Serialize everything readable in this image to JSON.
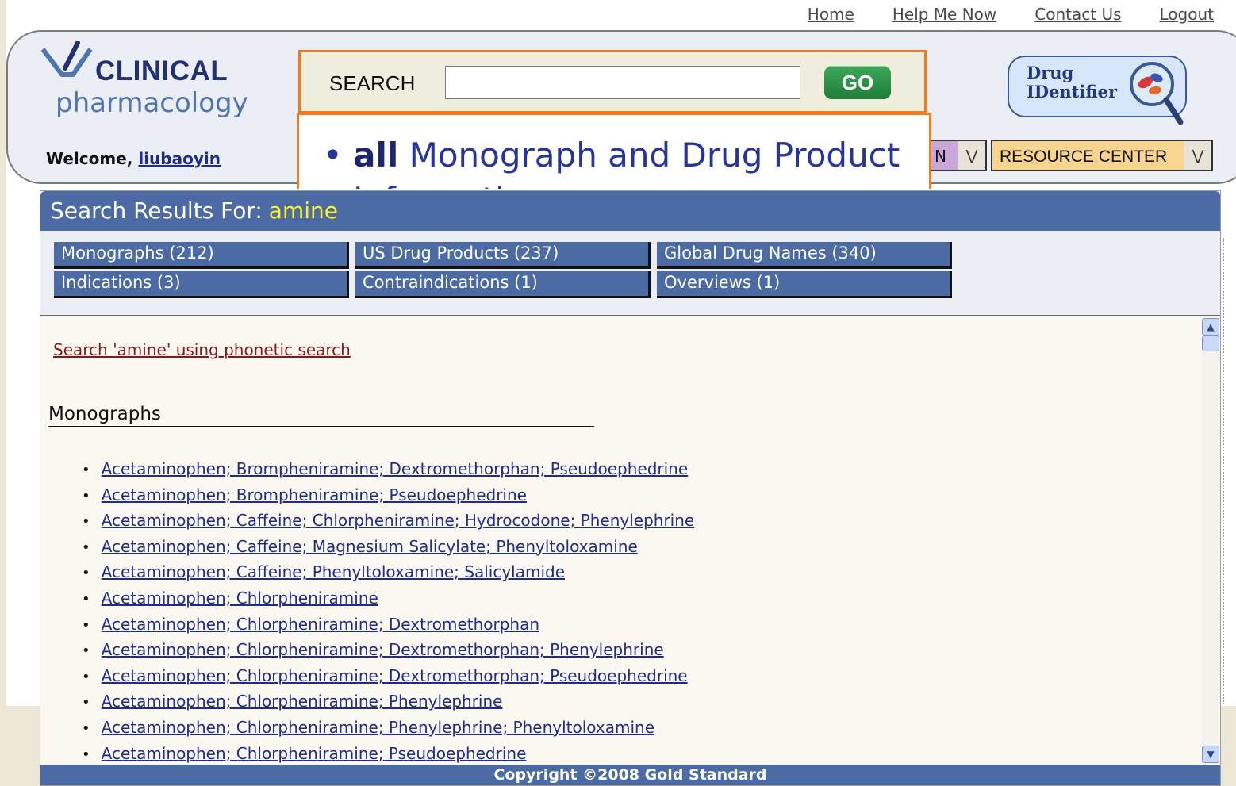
{
  "top_links": [
    "Home",
    "Help Me Now",
    "Contact Us",
    "Logout"
  ],
  "logo": {
    "line1": "CLINICAL",
    "line2": "pharmacology"
  },
  "welcome": {
    "prefix": "Welcome,",
    "user": "liubaoyin"
  },
  "search": {
    "label": "SEARCH",
    "value": "",
    "go": "GO"
  },
  "search_popup": {
    "bold": "all",
    "rest": "Monograph and Drug Product",
    "line2": "Information"
  },
  "drug_identifier": {
    "line1": "Drug",
    "line2": "IDentifier"
  },
  "header_select_left": "N",
  "resource_center": "RESOURCE CENTER",
  "results": {
    "title_prefix": "Search Results For:",
    "term": "amine",
    "tabs": [
      "Monographs (212)",
      "US Drug Products (237)",
      "Global Drug Names (340)",
      "Indications (3)",
      "Contraindications (1)",
      "Overviews (1)"
    ],
    "phonetic_link": "Search 'amine' using phonetic search",
    "section": "Monographs",
    "monographs": [
      "Acetaminophen; Brompheniramine; Dextromethorphan; Pseudoephedrine",
      "Acetaminophen; Brompheniramine; Pseudoephedrine",
      "Acetaminophen; Caffeine; Chlorpheniramine; Hydrocodone; Phenylephrine",
      "Acetaminophen; Caffeine; Magnesium Salicylate; Phenyltoloxamine",
      "Acetaminophen; Caffeine; Phenyltoloxamine; Salicylamide",
      "Acetaminophen; Chlorpheniramine",
      "Acetaminophen; Chlorpheniramine; Dextromethorphan",
      "Acetaminophen; Chlorpheniramine; Dextromethorphan; Phenylephrine",
      "Acetaminophen; Chlorpheniramine; Dextromethorphan; Pseudoephedrine",
      "Acetaminophen; Chlorpheniramine; Phenylephrine",
      "Acetaminophen; Chlorpheniramine; Phenylephrine; Phenyltoloxamine",
      "Acetaminophen; Chlorpheniramine; Pseudoephedrine"
    ],
    "footer": "Copyright ©2008 Gold Standard"
  },
  "colors": {
    "accent": "#4c6aa3",
    "search_border": "#f07c1c",
    "term": "#f6f12a"
  }
}
